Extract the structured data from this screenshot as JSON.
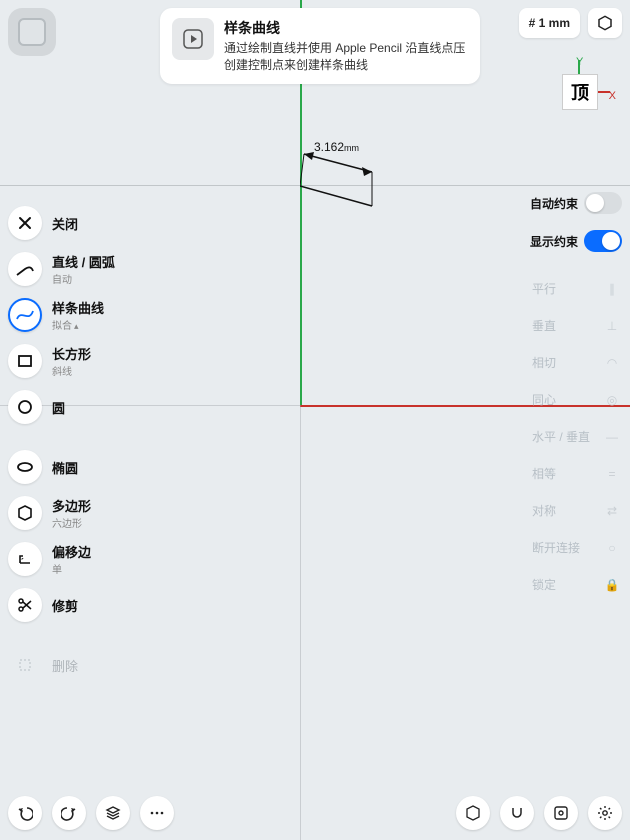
{
  "top_left_button": "model-view",
  "tooltip": {
    "title": "样条曲线",
    "desc": "通过绘制直线并使用 Apple Pencil 沿直线点压创建控制点来创建样条曲线"
  },
  "top_right": {
    "grid_chip": "# 1 mm"
  },
  "gizmo": {
    "face": "顶",
    "y": "Y",
    "x": "X"
  },
  "dimension": {
    "value": "3.162",
    "unit": "mm"
  },
  "tools": [
    {
      "id": "close",
      "title": "关闭",
      "sub": ""
    },
    {
      "id": "line",
      "title": "直线 / 圆弧",
      "sub": "自动"
    },
    {
      "id": "spline",
      "title": "样条曲线",
      "sub": "拟合"
    },
    {
      "id": "rect",
      "title": "长方形",
      "sub": "斜线"
    },
    {
      "id": "circle",
      "title": "圆",
      "sub": ""
    },
    {
      "id": "ellipse",
      "title": "椭圆",
      "sub": ""
    },
    {
      "id": "polygon",
      "title": "多边形",
      "sub": "六边形"
    },
    {
      "id": "offset",
      "title": "偏移边",
      "sub": "单"
    },
    {
      "id": "trim",
      "title": "修剪",
      "sub": ""
    },
    {
      "id": "delete",
      "title": "删除",
      "sub": ""
    }
  ],
  "right_panel": {
    "auto_label": "自动约束",
    "auto_on": false,
    "show_label": "显示约束",
    "show_on": true,
    "items": [
      {
        "id": "parallel",
        "label": "平行"
      },
      {
        "id": "perp",
        "label": "垂直"
      },
      {
        "id": "tangent",
        "label": "相切"
      },
      {
        "id": "concentric",
        "label": "同心"
      },
      {
        "id": "hv",
        "label": "水平 / 垂直"
      },
      {
        "id": "equal",
        "label": "相等"
      },
      {
        "id": "symmetric",
        "label": "对称"
      },
      {
        "id": "break",
        "label": "断开连接"
      },
      {
        "id": "lock",
        "label": "锁定"
      }
    ]
  },
  "bottom_left": [
    "undo",
    "redo",
    "layers",
    "more"
  ],
  "bottom_right": [
    "box",
    "snap",
    "ar",
    "settings"
  ]
}
